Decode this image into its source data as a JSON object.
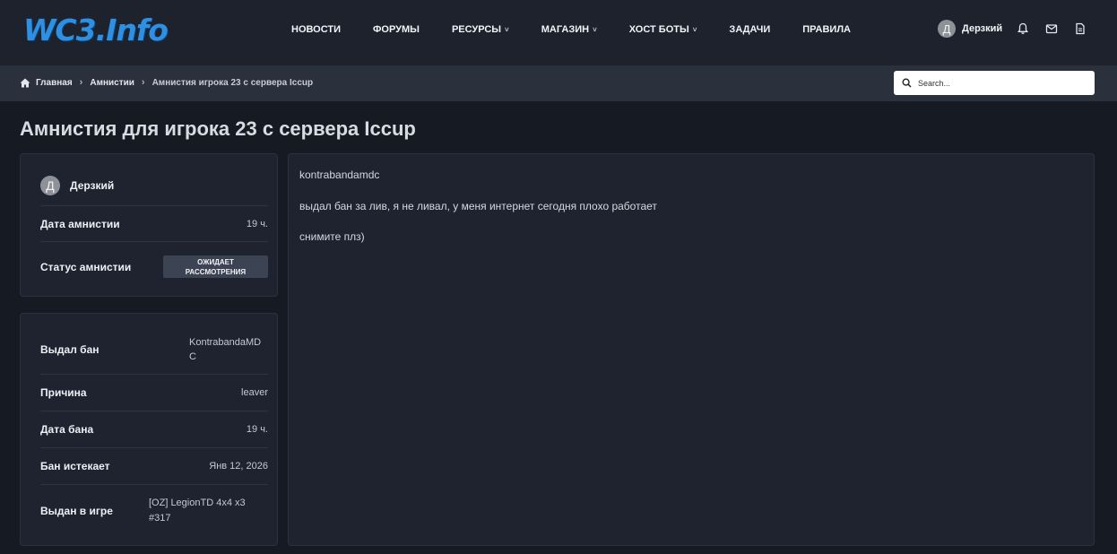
{
  "site": {
    "logo_text": "WC3.Info"
  },
  "nav": {
    "items": [
      {
        "label": "НОВОСТИ",
        "dropdown": false
      },
      {
        "label": "ФОРУМЫ",
        "dropdown": false
      },
      {
        "label": "РЕСУРСЫ",
        "dropdown": true
      },
      {
        "label": "МАГАЗИН",
        "dropdown": true
      },
      {
        "label": "ХОСТ БОТЫ",
        "dropdown": true
      },
      {
        "label": "ЗАДАЧИ",
        "dropdown": false
      },
      {
        "label": "ПРАВИЛА",
        "dropdown": false
      }
    ],
    "caret": "˅"
  },
  "user": {
    "avatar_letter": "Д",
    "name": "Дерзкий"
  },
  "icons": [
    "bell-icon",
    "envelope-icon",
    "document-icon",
    "home-icon",
    "chevron-right-icon",
    "search-icon"
  ],
  "breadcrumb": {
    "items": [
      "Главная",
      "Амнистии",
      "Амнистия игрока 23 с сервера Iccup"
    ],
    "separator": "›"
  },
  "search": {
    "placeholder": "Search..."
  },
  "page": {
    "title": "Амнистия для игрока 23 с сервера Iccup"
  },
  "amnesty": {
    "author_letter": "Д",
    "author": "Дерзкий",
    "date_label": "Дата амнистии",
    "date_value": "19 ч.",
    "status_label": "Статус амнистии",
    "status_line1": "ОЖИДАЕТ",
    "status_line2": "РАССМОТРЕНИЯ"
  },
  "ban": {
    "issued_by_label": "Выдал бан",
    "issued_by_line1": "KontrabandaMD",
    "issued_by_line2": "C",
    "reason_label": "Причина",
    "reason_value": "leaver",
    "date_label": "Дата бана",
    "date_value": "19 ч.",
    "expires_label": "Бан истекает",
    "expires_value": "Янв 12, 2026",
    "game_label": "Выдан в игре",
    "game_line1": "[OZ] LegionTD 4x4 x3",
    "game_line2": "#317"
  },
  "message": {
    "lines": [
      "kontrabandamdc",
      "выдал бан за лив, я не ливал, у меня интернет сегодня плохо работает",
      "снимите плз)"
    ]
  },
  "colors": {
    "accent": "#2f8fe0",
    "background": "#161a22",
    "panel": "#1f2330",
    "badge": "#3c4352"
  }
}
